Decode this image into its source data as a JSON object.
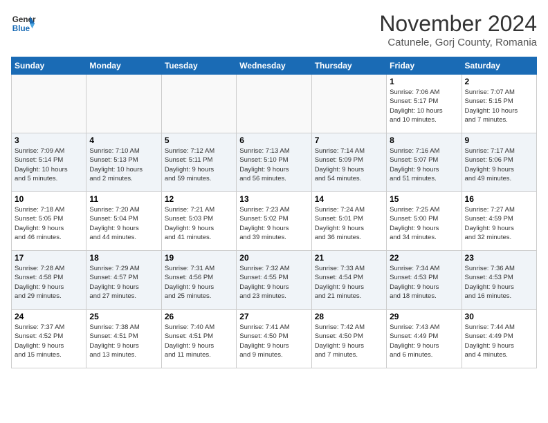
{
  "logo": {
    "line1": "General",
    "line2": "Blue"
  },
  "title": "November 2024",
  "subtitle": "Catunele, Gorj County, Romania",
  "weekdays": [
    "Sunday",
    "Monday",
    "Tuesday",
    "Wednesday",
    "Thursday",
    "Friday",
    "Saturday"
  ],
  "weeks": [
    [
      {
        "day": "",
        "info": ""
      },
      {
        "day": "",
        "info": ""
      },
      {
        "day": "",
        "info": ""
      },
      {
        "day": "",
        "info": ""
      },
      {
        "day": "",
        "info": ""
      },
      {
        "day": "1",
        "info": "Sunrise: 7:06 AM\nSunset: 5:17 PM\nDaylight: 10 hours\nand 10 minutes."
      },
      {
        "day": "2",
        "info": "Sunrise: 7:07 AM\nSunset: 5:15 PM\nDaylight: 10 hours\nand 7 minutes."
      }
    ],
    [
      {
        "day": "3",
        "info": "Sunrise: 7:09 AM\nSunset: 5:14 PM\nDaylight: 10 hours\nand 5 minutes."
      },
      {
        "day": "4",
        "info": "Sunrise: 7:10 AM\nSunset: 5:13 PM\nDaylight: 10 hours\nand 2 minutes."
      },
      {
        "day": "5",
        "info": "Sunrise: 7:12 AM\nSunset: 5:11 PM\nDaylight: 9 hours\nand 59 minutes."
      },
      {
        "day": "6",
        "info": "Sunrise: 7:13 AM\nSunset: 5:10 PM\nDaylight: 9 hours\nand 56 minutes."
      },
      {
        "day": "7",
        "info": "Sunrise: 7:14 AM\nSunset: 5:09 PM\nDaylight: 9 hours\nand 54 minutes."
      },
      {
        "day": "8",
        "info": "Sunrise: 7:16 AM\nSunset: 5:07 PM\nDaylight: 9 hours\nand 51 minutes."
      },
      {
        "day": "9",
        "info": "Sunrise: 7:17 AM\nSunset: 5:06 PM\nDaylight: 9 hours\nand 49 minutes."
      }
    ],
    [
      {
        "day": "10",
        "info": "Sunrise: 7:18 AM\nSunset: 5:05 PM\nDaylight: 9 hours\nand 46 minutes."
      },
      {
        "day": "11",
        "info": "Sunrise: 7:20 AM\nSunset: 5:04 PM\nDaylight: 9 hours\nand 44 minutes."
      },
      {
        "day": "12",
        "info": "Sunrise: 7:21 AM\nSunset: 5:03 PM\nDaylight: 9 hours\nand 41 minutes."
      },
      {
        "day": "13",
        "info": "Sunrise: 7:23 AM\nSunset: 5:02 PM\nDaylight: 9 hours\nand 39 minutes."
      },
      {
        "day": "14",
        "info": "Sunrise: 7:24 AM\nSunset: 5:01 PM\nDaylight: 9 hours\nand 36 minutes."
      },
      {
        "day": "15",
        "info": "Sunrise: 7:25 AM\nSunset: 5:00 PM\nDaylight: 9 hours\nand 34 minutes."
      },
      {
        "day": "16",
        "info": "Sunrise: 7:27 AM\nSunset: 4:59 PM\nDaylight: 9 hours\nand 32 minutes."
      }
    ],
    [
      {
        "day": "17",
        "info": "Sunrise: 7:28 AM\nSunset: 4:58 PM\nDaylight: 9 hours\nand 29 minutes."
      },
      {
        "day": "18",
        "info": "Sunrise: 7:29 AM\nSunset: 4:57 PM\nDaylight: 9 hours\nand 27 minutes."
      },
      {
        "day": "19",
        "info": "Sunrise: 7:31 AM\nSunset: 4:56 PM\nDaylight: 9 hours\nand 25 minutes."
      },
      {
        "day": "20",
        "info": "Sunrise: 7:32 AM\nSunset: 4:55 PM\nDaylight: 9 hours\nand 23 minutes."
      },
      {
        "day": "21",
        "info": "Sunrise: 7:33 AM\nSunset: 4:54 PM\nDaylight: 9 hours\nand 21 minutes."
      },
      {
        "day": "22",
        "info": "Sunrise: 7:34 AM\nSunset: 4:53 PM\nDaylight: 9 hours\nand 18 minutes."
      },
      {
        "day": "23",
        "info": "Sunrise: 7:36 AM\nSunset: 4:53 PM\nDaylight: 9 hours\nand 16 minutes."
      }
    ],
    [
      {
        "day": "24",
        "info": "Sunrise: 7:37 AM\nSunset: 4:52 PM\nDaylight: 9 hours\nand 15 minutes."
      },
      {
        "day": "25",
        "info": "Sunrise: 7:38 AM\nSunset: 4:51 PM\nDaylight: 9 hours\nand 13 minutes."
      },
      {
        "day": "26",
        "info": "Sunrise: 7:40 AM\nSunset: 4:51 PM\nDaylight: 9 hours\nand 11 minutes."
      },
      {
        "day": "27",
        "info": "Sunrise: 7:41 AM\nSunset: 4:50 PM\nDaylight: 9 hours\nand 9 minutes."
      },
      {
        "day": "28",
        "info": "Sunrise: 7:42 AM\nSunset: 4:50 PM\nDaylight: 9 hours\nand 7 minutes."
      },
      {
        "day": "29",
        "info": "Sunrise: 7:43 AM\nSunset: 4:49 PM\nDaylight: 9 hours\nand 6 minutes."
      },
      {
        "day": "30",
        "info": "Sunrise: 7:44 AM\nSunset: 4:49 PM\nDaylight: 9 hours\nand 4 minutes."
      }
    ]
  ]
}
